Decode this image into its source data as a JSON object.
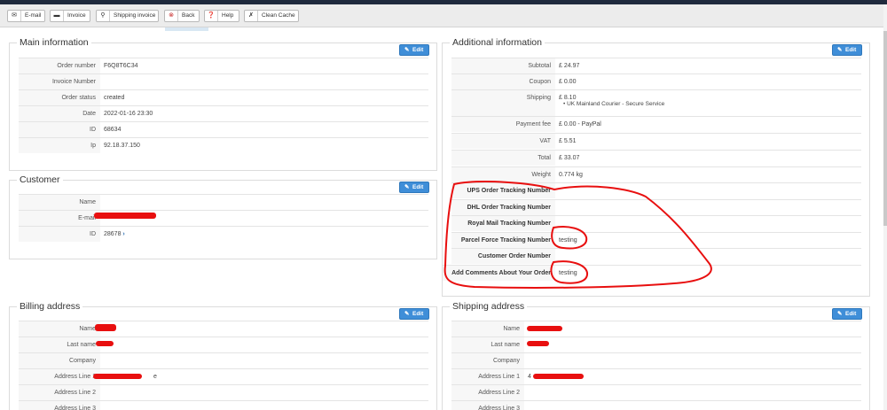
{
  "toolbar": {
    "buttons": [
      {
        "icon": "email-icon",
        "label": "E-mail"
      },
      {
        "icon": "invoice-icon",
        "label": "Invoice"
      },
      {
        "icon": "shipping-pin-icon",
        "label": "Shipping invoice"
      },
      {
        "icon": "back-icon",
        "label": "Back"
      },
      {
        "icon": "help-icon",
        "label": "Help"
      },
      {
        "icon": "clean-icon",
        "label": "Clean Cache"
      }
    ]
  },
  "edit_label": "Edit",
  "main_info": {
    "title": "Main information",
    "rows": [
      {
        "label": "Order number",
        "value": "F6Q8T6C34"
      },
      {
        "label": "Invoice Number",
        "value": ""
      },
      {
        "label": "Order status",
        "value": "created"
      },
      {
        "label": "Date",
        "value": "2022-01-16 23:30"
      },
      {
        "label": "ID",
        "value": "68634"
      },
      {
        "label": "Ip",
        "value": "92.18.37.150"
      }
    ]
  },
  "customer": {
    "title": "Customer",
    "rows": [
      {
        "label": "Name",
        "value": ""
      },
      {
        "label": "E-mail",
        "value": ""
      },
      {
        "label": "ID",
        "value": "28678"
      }
    ],
    "id_chevron": "›"
  },
  "additional_info": {
    "title": "Additional information",
    "rows": [
      {
        "label": "Subtotal",
        "value": "£ 24.97"
      },
      {
        "label": "Coupon",
        "value": "£ 0.00"
      },
      {
        "label": "Shipping",
        "value": "£ 8.10"
      },
      {
        "label": "Payment fee",
        "value": "£ 0.00 - PayPal"
      },
      {
        "label": "VAT",
        "value": "£ 5.51"
      },
      {
        "label": "Total",
        "value": "£ 33.07"
      },
      {
        "label": "Weight",
        "value": "0.774 kg"
      },
      {
        "label": "UPS Order Tracking Number",
        "value": ""
      },
      {
        "label": "DHL Order Tracking Number",
        "value": ""
      },
      {
        "label": "Royal Mail Tracking Number",
        "value": ""
      },
      {
        "label": "Parcel Force Tracking Number",
        "value": "testing"
      },
      {
        "label": "Customer Order Number",
        "value": ""
      },
      {
        "label": "Add Comments About Your Order",
        "value": "testing"
      }
    ],
    "shipping_method": "UK Mainland Courier - Secure Service"
  },
  "billing": {
    "title": "Billing address",
    "rows": [
      {
        "label": "Name",
        "value": ""
      },
      {
        "label": "Last name",
        "value": ""
      },
      {
        "label": "Company",
        "value": ""
      },
      {
        "label": "Address Line 1",
        "value": "e"
      },
      {
        "label": "Address Line 2",
        "value": ""
      },
      {
        "label": "Address Line 3",
        "value": ""
      }
    ]
  },
  "shipping": {
    "title": "Shipping address",
    "rows": [
      {
        "label": "Name",
        "value": ""
      },
      {
        "label": "Last name",
        "value": ""
      },
      {
        "label": "Company",
        "value": ""
      },
      {
        "label": "Address Line 1",
        "value": "4"
      },
      {
        "label": "Address Line 2",
        "value": ""
      },
      {
        "label": "Address Line 3",
        "value": ""
      }
    ]
  },
  "colors": {
    "edit_button": "#3f8ed8",
    "annotation_red": "#e80f0f",
    "toolbar_bg": "#ececec"
  }
}
